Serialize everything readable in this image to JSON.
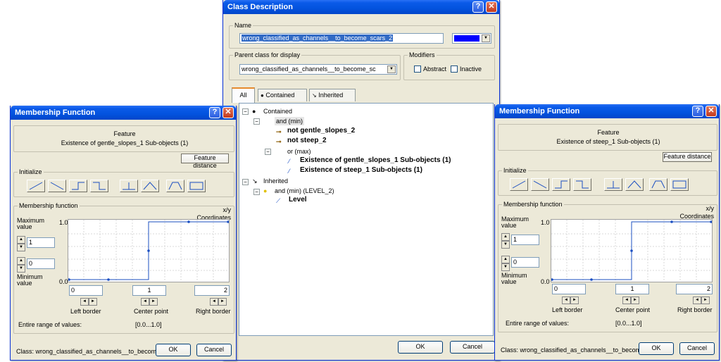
{
  "class_description": {
    "title": "Class Description",
    "name_label": "Name",
    "name_value": "wrong_classified_as_channels__to_become_scars_2",
    "class_color": "#0000ff",
    "parent_label": "Parent class for display",
    "parent_value": "wrong_classified_as_channels__to_become_sc",
    "modifiers_label": "Modifiers",
    "abstract_label": "Abstract",
    "inactive_label": "Inactive",
    "tabs": [
      "All",
      "Contained",
      "Inherited"
    ],
    "tree": {
      "contained": "Contained",
      "and_min": "and (min)",
      "not_gentle": "not gentle_slopes_2",
      "not_steep": "not steep_2",
      "or_max": "or (max)",
      "exist_gentle": "Existence of gentle_slopes_1 Sub-objects  (1)",
      "exist_steep": "Existence of steep_1 Sub-objects  (1)",
      "inherited": "Inherited",
      "and_min_level": "and (min) (LEVEL_2)",
      "level": "Level"
    },
    "ok": "OK",
    "cancel": "Cancel"
  },
  "mf_left": {
    "title": "Membership Function",
    "feature_label": "Feature",
    "feature_name": "Existence of gentle_slopes_1 Sub-objects  (1)",
    "feature_distance": "Feature distance",
    "initialize_label": "Initialize",
    "mf_label": "Membership function",
    "xy": "x/y",
    "coordinates": "Coordinates",
    "max_label": "Maximum value",
    "min_label": "Minimum value",
    "max_value": "1",
    "min_value": "0",
    "y_top": "1.0",
    "y_bottom": "0.0",
    "left_border_value": "0",
    "center_value": "1",
    "right_value": "2",
    "left_border": "Left border",
    "center_point": "Center point",
    "right_border": "Right border",
    "range_label": "Entire range of values:",
    "range_value": "[0.0...1.0]",
    "class_text": "Class: wrong_classified_as_channels__to_become_",
    "ok": "OK",
    "cancel": "Cancel"
  },
  "mf_right": {
    "title": "Membership Function",
    "feature_label": "Feature",
    "feature_name": "Existence of steep_1 Sub-objects  (1)",
    "feature_distance": "Feature distance",
    "initialize_label": "Initialize",
    "mf_label": "Membership function",
    "xy": "x/y",
    "coordinates": "Coordinates",
    "max_label": "Maximum value",
    "min_label": "Minimum value",
    "max_value": "1",
    "min_value": "0",
    "y_top": "1.0",
    "y_bottom": "0.0",
    "left_border_value": "0",
    "center_value": "1",
    "right_value": "2",
    "left_border": "Left border",
    "center_point": "Center point",
    "right_border": "Right border",
    "range_label": "Entire range of values:",
    "range_value": "[0.0...1.0]",
    "class_text": "Class: wrong_classified_as_channels__to_become_",
    "ok": "OK",
    "cancel": "Cancel"
  }
}
